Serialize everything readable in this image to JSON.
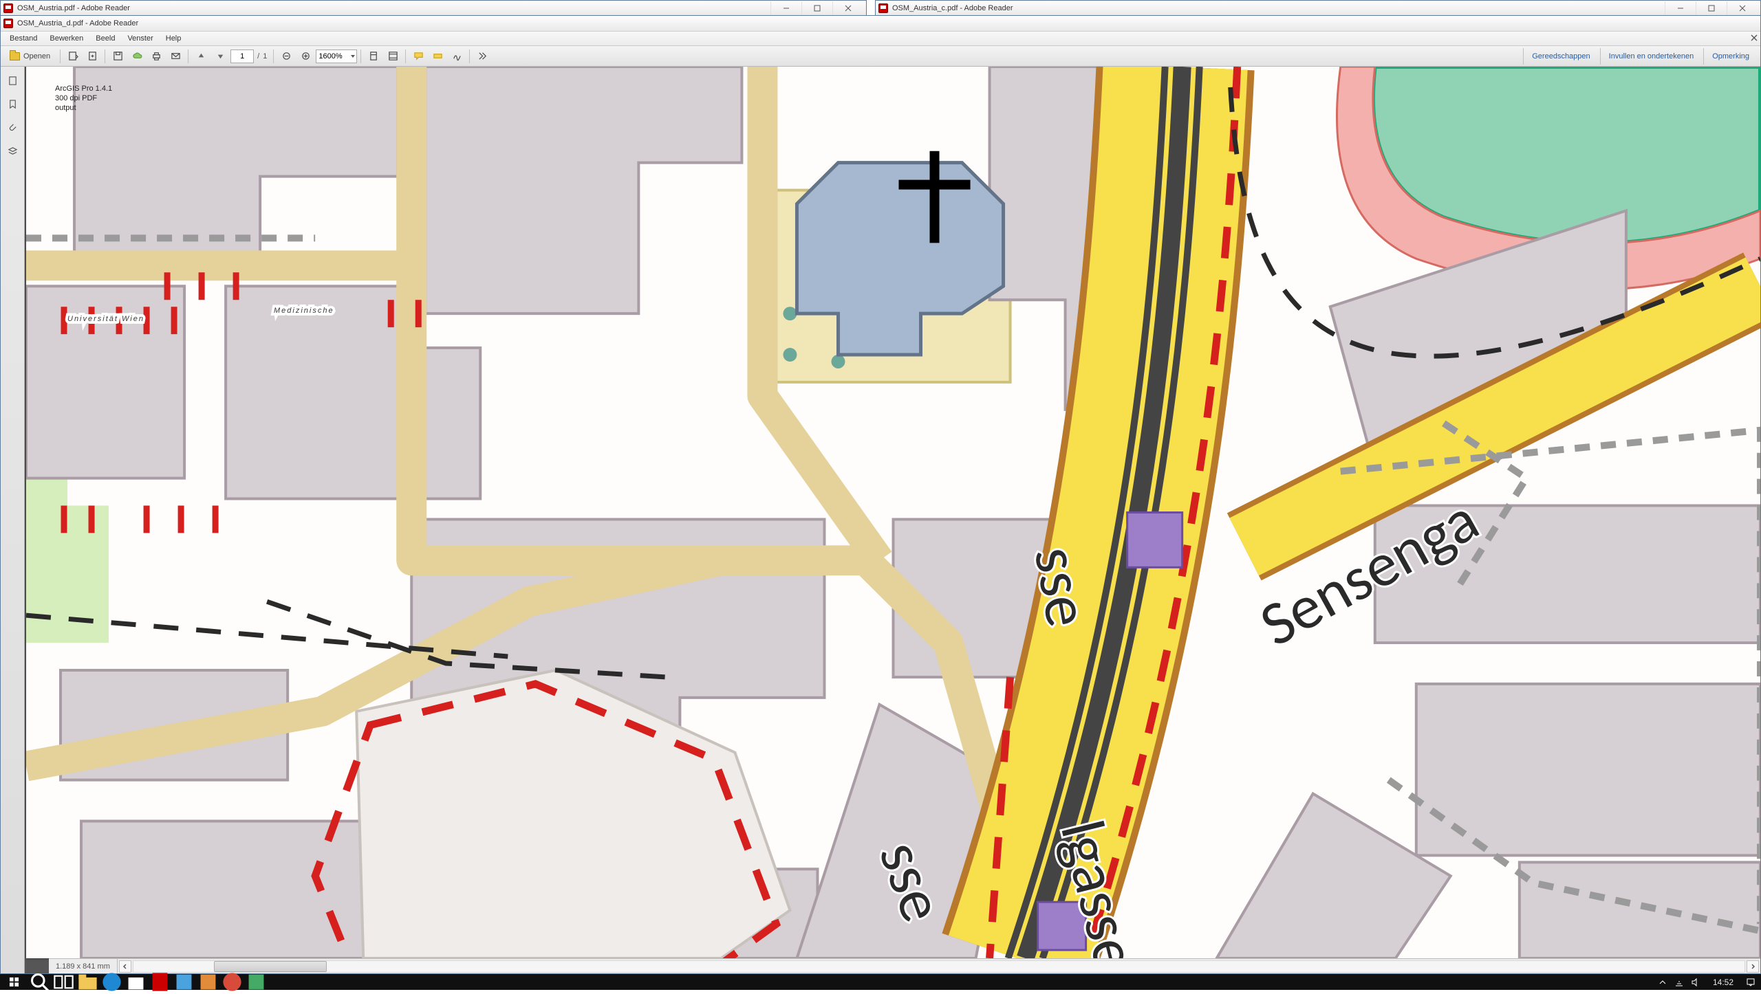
{
  "windows": {
    "back": {
      "title": "OSM_Austria.pdf - Adobe Reader"
    },
    "right": {
      "title": "OSM_Austria_c.pdf - Adobe Reader"
    },
    "front": {
      "title": "OSM_Austria_d.pdf - Adobe Reader"
    }
  },
  "menu": {
    "items": [
      "Bestand",
      "Bewerken",
      "Beeld",
      "Venster",
      "Help"
    ]
  },
  "toolbar": {
    "open_label": "Openen",
    "page_current": "1",
    "page_separator": "/",
    "page_total": "1",
    "zoom": "1600%",
    "right_buttons": [
      "Gereedschappen",
      "Invullen en ondertekenen",
      "Opmerking"
    ]
  },
  "status": {
    "dimensions": "1.189 x 841 mm"
  },
  "map": {
    "annotation_lines": [
      "ArcGIS Pro 1.4.1",
      "300 dpi PDF",
      "output"
    ],
    "place_label_line1": "Medizinische",
    "place_label_line2": "Universität Wien",
    "road_labels": {
      "spitalgasse": "lgasse",
      "sensengasse": "Sensenga",
      "sse1": "sse",
      "sse2": "sse"
    }
  },
  "taskbar": {
    "clock": "14:52"
  }
}
